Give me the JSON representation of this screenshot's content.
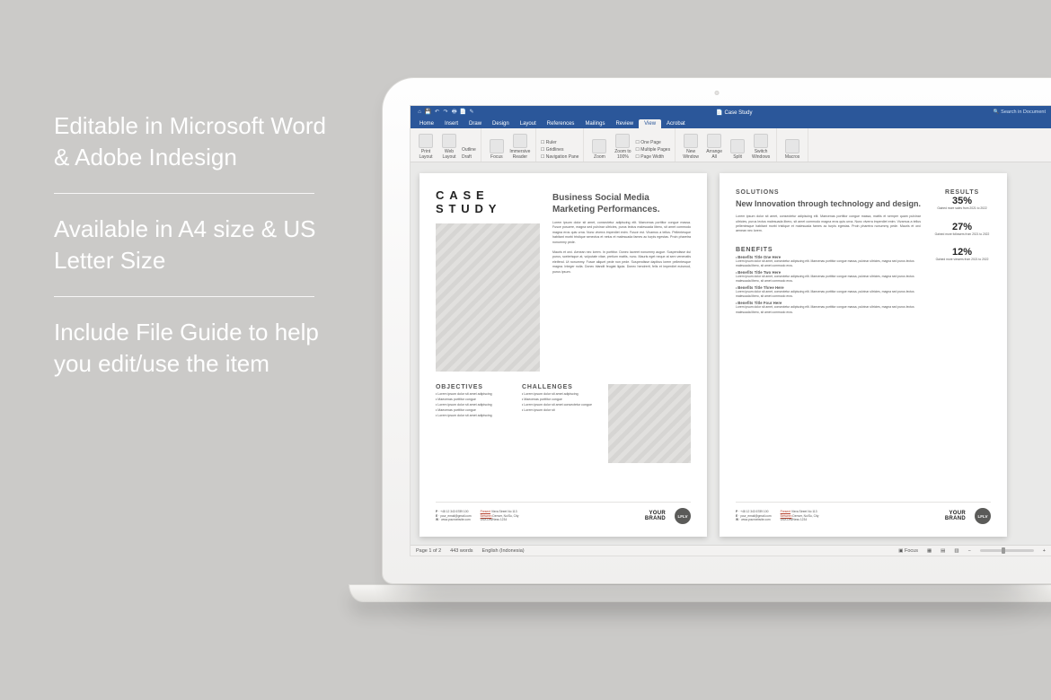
{
  "promo": {
    "line1": "Editable in Microsoft Word & Adobe Indesign",
    "line2": "Available in A4 size & US Letter Size",
    "line3": "Include File Guide to help you edit/use the item"
  },
  "word": {
    "doc_title": "Case Study",
    "search_placeholder": "Search in Document",
    "tabs": [
      "Home",
      "Insert",
      "Draw",
      "Design",
      "Layout",
      "References",
      "Mailings",
      "Review",
      "View",
      "Acrobat"
    ],
    "active_tab": "View",
    "ribbon": {
      "views": [
        "Print Layout",
        "Web Layout",
        "Outline",
        "Draft"
      ],
      "immersive": [
        "Focus",
        "Immersive Reader"
      ],
      "show": [
        "Ruler",
        "Gridlines",
        "Navigation Pane"
      ],
      "zoom": [
        "Zoom",
        "Zoom to 100%"
      ],
      "page_opts": [
        "One Page",
        "Multiple Pages",
        "Page Width"
      ],
      "window": [
        "New Window",
        "Arrange All",
        "Split",
        "Switch Windows"
      ],
      "macros": "Macros"
    },
    "status": {
      "page": "Page 1 of 2",
      "words": "443 words",
      "lang": "English (Indonesia)",
      "focus": "Focus"
    }
  },
  "doc": {
    "p1": {
      "case_l1": "CASE",
      "case_l2": "STUDY",
      "tagline": "Business Social Media Marketing Performances.",
      "para1": "Lorem ipsum dolor sit amet, consectetur adipiscing elit. Maecenas porttitor congue massa. Fusce posuere, magna sed pulvinar ultricies, purus lectus malesuada libero, sit amet commodo magna eros quis urna. Nunc viverra imperdiet enim. Fusce est. Vivamus a tellus. Pellentesque habitant morbi tristique senectus et netus et malesuada fames ac turpis egestas. Proin pharetra nonummy pede.",
      "para2": "Mauris et orci. Aenean nec lorem. In porttitor. Donec laoreet nonummy augue. Suspendisse dui purus, scelerisque at, vulputate vitae, pretium mattis, nunc. Mauris eget neque at sem venenatis eleifend. Ut nonummy. Fusce aliquet pede non pede. Suspendisse dapibus lorem pellentesque magna. Integer nulla. Donec blandit feugiat ligula. Donec hendrerit, felis et imperdiet euismod, purus ipsum.",
      "obj_title": "OBJECTIVES",
      "obj": [
        "Lorem ipsum dolor sit amet adipiscing",
        "Maecenas porttitor congue",
        "Lorem ipsum dolor sit amet adipiscing",
        "Maecenas porttitor congue",
        "Lorem ipsum dolor sit amet adipiscing"
      ],
      "cha_title": "CHALLENGES",
      "cha": [
        "Lorem ipsum dolor sit amet adipiscing",
        "Maecenas porttitor congue",
        "Lorem ipsum dolor sit amet consectetur congue",
        "Lorem ipsum dolor sit"
      ]
    },
    "p2": {
      "sol_title": "SOLUTIONS",
      "sol_heading": "New Innovation through technology and design.",
      "sol_body": "Lorem ipsum dolor sit amet, consectetur adipiscing elit. Maecenas porttitor congue massa, mattis et semper quam pulvinar ultricies, purus lectus malesuada libero, sit amet commodo magna eros quis urna. Nunc viverra imperdiet enim. Vivamus a tellus pellentesque habitant morbi tristique et malesuada fames ac turpis egestas. Proin pharetra nonummy pede. Mauris et orci aenean nec lorem.",
      "ben_title": "BENEFITS",
      "benefits": [
        {
          "t": "Benefits Title One Here",
          "b": "Lorem ipsum dolor sit amet, consectetur adipiscing elit. Maecenas porttitor congue massa, pulvinar ultricies, magna sed purus lectus malesuada libero, sit amet commodo eros."
        },
        {
          "t": "Benefits Title Two Here",
          "b": "Lorem ipsum dolor sit amet, consectetur adipiscing elit. Maecenas porttitor congue massa, pulvinar ultricies, magna sed purus lectus malesuada libero, sit amet commodo eros."
        },
        {
          "t": "Benefits Title Three Here",
          "b": "Lorem ipsum dolor sit amet, consectetur adipiscing elit. Maecenas porttitor congue massa, pulvinar ultricies, magna sed purus lectus malesuada libero, sit amet commodo eros."
        },
        {
          "t": "Benefits Title Four Here",
          "b": "Lorem ipsum dolor sit amet, consectetur adipiscing elit. Maecenas porttitor congue massa, pulvinar ultricies, magna sed purus lectus malesuada libero, sit amet commodo eros."
        }
      ],
      "res_title": "RESULTS",
      "stats": [
        {
          "n": "35%",
          "d": "Gained more sales from 2021 to 2022"
        },
        {
          "n": "27%",
          "d": "Gained more followers from 2021 to 2022"
        },
        {
          "n": "12%",
          "d": "Gained more viewers from 2021 to 2022"
        }
      ]
    },
    "footer": {
      "phone_l": "P",
      "phone": "+48 12 343 6789 100",
      "email_l": "E",
      "email": "your_email@gmail.com",
      "web_l": "W",
      "web": "www.yourwebsite.com",
      "p_l": "Present",
      "present": "Viera Street No 113",
      "r_l": "Between",
      "region": "Denver, No/Su, City",
      "c_l": "USA",
      "country": "Les/Ness 1234",
      "brand_l1": "YOUR",
      "brand_l2": "BRAND",
      "logo": "LFLV"
    }
  }
}
